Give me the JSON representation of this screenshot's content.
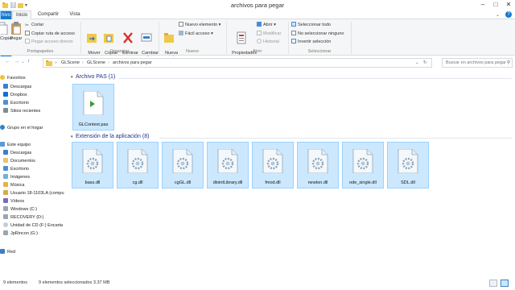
{
  "window": {
    "title": "archivos para pegar",
    "minimize_glyph": "–",
    "maximize_glyph": "□",
    "close_glyph": "✕"
  },
  "ribbon_tabs": [
    {
      "label": "hivo"
    },
    {
      "label": "Inicio"
    },
    {
      "label": "Compartir"
    },
    {
      "label": "Vista"
    }
  ],
  "ribbon": {
    "portapapeles": {
      "copy": "Copiar",
      "paste": "Pegar",
      "cut": "Cortar",
      "copy_path": "Copiar ruta de acceso",
      "paste_shortcut": "Pegar acceso directo",
      "group": "Portapapeles"
    },
    "organizar": {
      "move_to": "Mover\na ▾",
      "copy_to": "Copiar\na ▾",
      "delete": "Eliminar\n▾",
      "rename": "Cambiar\nnombre",
      "group": "Organizar"
    },
    "nuevo": {
      "new_folder": "Nueva\ncarpeta",
      "new_item": "Nuevo elemento ▾",
      "easy_access": "Fácil acceso ▾",
      "group": "Nuevo"
    },
    "abrir": {
      "properties": "Propiedades\n▾",
      "open": "Abrir ▾",
      "modify": "Modificar",
      "history": "Historial",
      "group": "Abrir"
    },
    "seleccionar": {
      "select_all": "Seleccionar todo",
      "select_none": "No seleccionar ninguno",
      "invert": "Invertir selección",
      "group": "Seleccionar"
    }
  },
  "address": {
    "back": "←",
    "forward": "→",
    "recent": "⌄",
    "up": "↑",
    "crumbs": [
      "»",
      "GLScene",
      "›",
      "GLScene",
      "›",
      "archivos para pegar"
    ],
    "dropdown": "⌄",
    "refresh": "↻",
    "search_placeholder": "Buscar en archivos para pegar"
  },
  "nav": {
    "favorites": "Favoritos",
    "downloads": "Descargas",
    "dropbox": "Dropbox",
    "desktop": "Escritorio",
    "recent_sites": "Sitios recientes",
    "homegroup": "Grupo en el hogar",
    "this_pc": "Este equipo",
    "pc_downloads": "Descargas",
    "documents": "Documentos",
    "pc_desktop": "Escritorio",
    "images": "Imágenes",
    "music": "Música",
    "user": "Usuario 18-1103LA (compu",
    "videos": "Vídeos",
    "windows": "Windows (C:)",
    "recovery": "RECOVERY (D:)",
    "cd_drive": "Unidad de CD (F:) Encarta",
    "jprincon": "JpRincon (G:)",
    "network": "Red"
  },
  "groups": [
    {
      "header": "Archivo PAS (1)",
      "files": [
        {
          "name": "GLContext.pas"
        }
      ]
    },
    {
      "header": "Extensión de la aplicación (8)",
      "files": [
        {
          "name": "bass.dll"
        },
        {
          "name": "cg.dll"
        },
        {
          "name": "cgGL.dll"
        },
        {
          "name": "dlointLibrary.dll"
        },
        {
          "name": "fmod.dll"
        },
        {
          "name": "newton.dll"
        },
        {
          "name": "ode_single.dll"
        },
        {
          "name": "SDL.dll"
        }
      ]
    }
  ],
  "status": {
    "items": "9 elementos",
    "selected": "9 elementos seleccionados  3.37 MB"
  },
  "colors": {
    "accent": "#1979ca",
    "selection_fill": "#cce8ff",
    "selection_border": "#99d1ff",
    "group_header": "#1e3287"
  }
}
